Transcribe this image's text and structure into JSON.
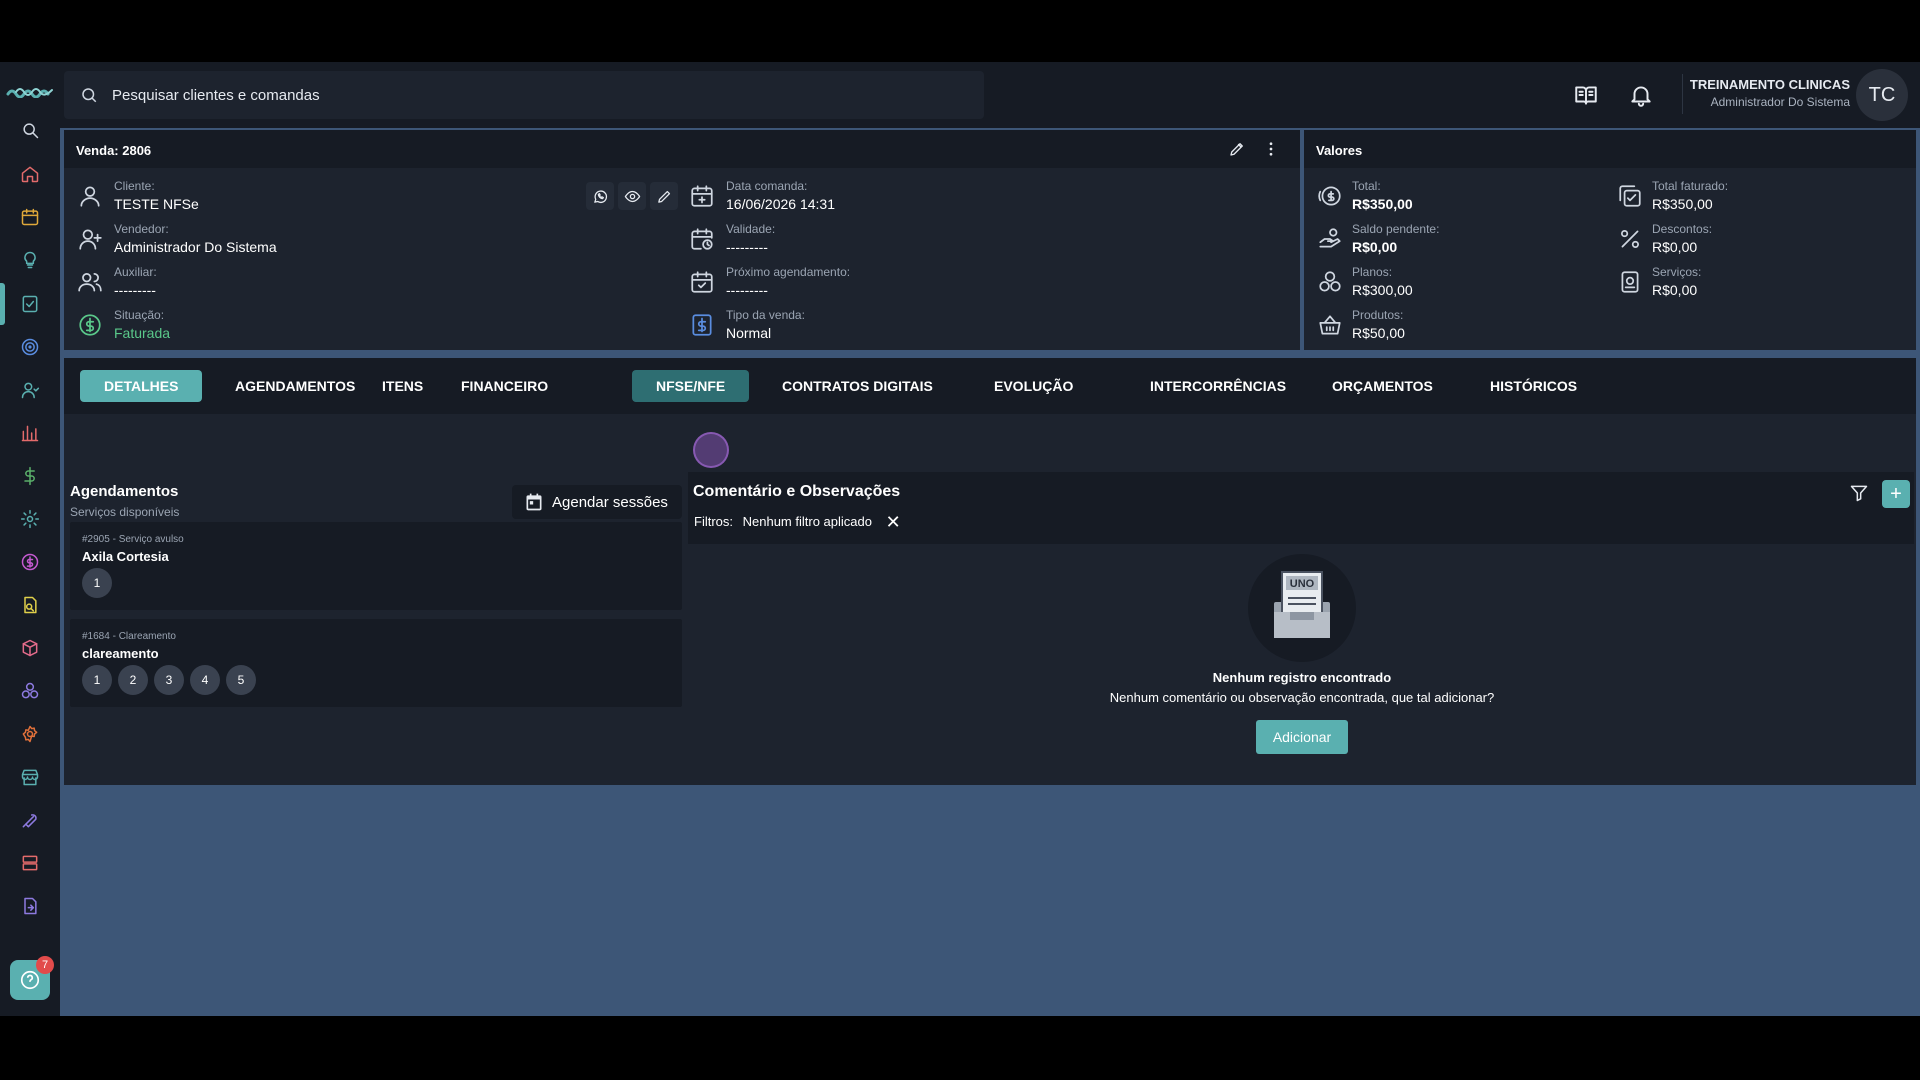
{
  "search": {
    "placeholder": "Pesquisar clientes e comandas"
  },
  "user": {
    "name": "TREINAMENTO CLINICAS",
    "role": "Administrador Do Sistema",
    "initials": "TC"
  },
  "help": {
    "badge": "7"
  },
  "sale": {
    "title": "Venda: 2806",
    "fields": {
      "cliente": {
        "label": "Cliente:",
        "value": "TESTE NFSe"
      },
      "vendedor": {
        "label": "Vendedor:",
        "value": "Administrador Do Sistema"
      },
      "auxiliar": {
        "label": "Auxiliar:",
        "value": "---------"
      },
      "situacao": {
        "label": "Situação:",
        "value": "Faturada"
      },
      "data_comanda": {
        "label": "Data comanda:",
        "value": "16/06/2026 14:31"
      },
      "validade": {
        "label": "Validade:",
        "value": "---------"
      },
      "proximo": {
        "label": "Próximo agendamento:",
        "value": "---------"
      },
      "tipo": {
        "label": "Tipo da venda:",
        "value": "Normal"
      }
    }
  },
  "valores": {
    "title": "Valores",
    "total": {
      "label": "Total:",
      "value": "R$350,00"
    },
    "saldo": {
      "label": "Saldo pendente:",
      "value": "R$0,00"
    },
    "planos": {
      "label": "Planos:",
      "value": "R$300,00"
    },
    "produtos": {
      "label": "Produtos:",
      "value": "R$50,00"
    },
    "faturado": {
      "label": "Total faturado:",
      "value": "R$350,00"
    },
    "descontos": {
      "label": "Descontos:",
      "value": "R$0,00"
    },
    "servicos": {
      "label": "Serviços:",
      "value": "R$0,00"
    }
  },
  "tabs": [
    "DETALHES",
    "AGENDAMENTOS",
    "ITENS",
    "FINANCEIRO",
    "NFSE/NFE",
    "CONTRATOS DIGITAIS",
    "EVOLUÇÃO",
    "INTERCORRÊNCIAS",
    "ORÇAMENTOS",
    "HISTÓRICOS"
  ],
  "agendamentos": {
    "title": "Agendamentos",
    "subtitle": "Serviços disponíveis",
    "button": "Agendar sessões",
    "services": [
      {
        "code": "#2905 - Serviço avulso",
        "name": "Axila Cortesia",
        "sessions": [
          "1"
        ]
      },
      {
        "code": "#1684 - Clareamento",
        "name": "clareamento",
        "sessions": [
          "1",
          "2",
          "3",
          "4",
          "5"
        ]
      }
    ]
  },
  "comentarios": {
    "title": "Comentário e Observações",
    "filters_label": "Filtros:",
    "filters_value": "Nenhum filtro aplicado",
    "empty_icon_text": "UNO",
    "empty_title": "Nenhum registro encontrado",
    "empty_sub": "Nenhum comentário ou observação encontrada, que tal adicionar?",
    "add_label": "Adicionar"
  },
  "colors": {
    "accent": "#5ab0b0",
    "panel": "#1d232e",
    "panel_dark": "#161b24",
    "background": "#3d5677"
  }
}
